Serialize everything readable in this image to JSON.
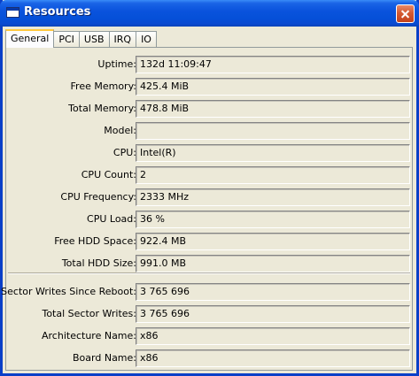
{
  "window": {
    "title": "Resources"
  },
  "tabs": [
    {
      "label": "General",
      "active": true
    },
    {
      "label": "PCI",
      "active": false
    },
    {
      "label": "USB",
      "active": false
    },
    {
      "label": "IRQ",
      "active": false
    },
    {
      "label": "IO",
      "active": false
    }
  ],
  "fields": [
    {
      "label": "Uptime:",
      "value": "132d 11:09:47"
    },
    {
      "label": "Free Memory:",
      "value": "425.4 MiB"
    },
    {
      "label": "Total Memory:",
      "value": "478.8 MiB"
    },
    {
      "label": "Model:",
      "value": ""
    },
    {
      "label": "CPU:",
      "value": "Intel(R)"
    },
    {
      "label": "CPU Count:",
      "value": "2"
    },
    {
      "label": "CPU Frequency:",
      "value": "2333 MHz"
    },
    {
      "label": "CPU Load:",
      "value": "36 %"
    },
    {
      "label": "Free HDD Space:",
      "value": "922.4 MB"
    },
    {
      "label": "Total HDD Size:",
      "value": "991.0 MB"
    }
  ],
  "fields2": [
    {
      "label": "Sector Writes Since Reboot:",
      "value": "3 765 696"
    },
    {
      "label": "Total Sector Writes:",
      "value": "3 765 696"
    },
    {
      "label": "Architecture Name:",
      "value": "x86"
    },
    {
      "label": "Board Name:",
      "value": "x86"
    }
  ],
  "colors": {
    "titlebar": "#0a53dd",
    "window_bg": "#ece9d8",
    "active_tab_accent": "#ffc83c",
    "close_button": "#d45a32"
  },
  "icons": {
    "window_icon": "window-icon",
    "close_icon": "close-icon"
  }
}
